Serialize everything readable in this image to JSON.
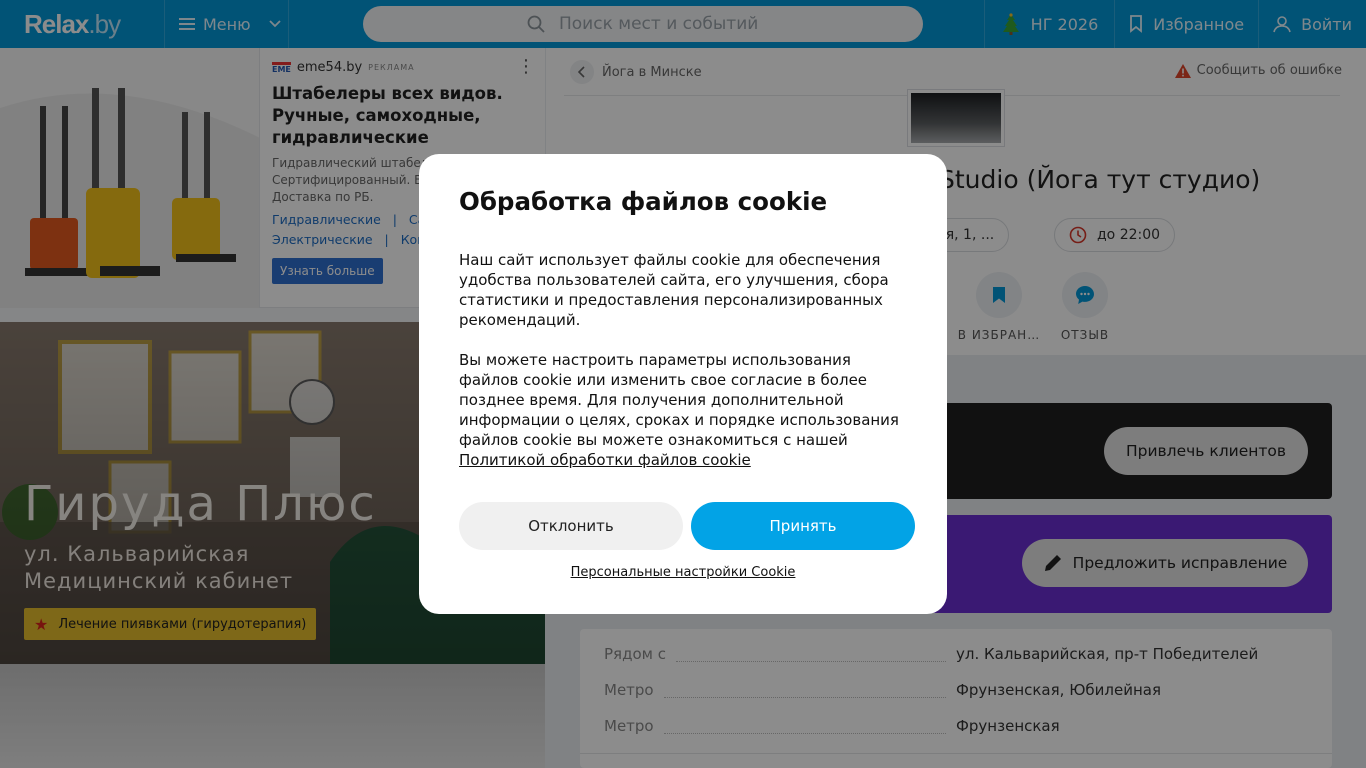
{
  "header": {
    "logo_main": "Relax",
    "logo_domain": ".by",
    "menu_label": "Меню",
    "search_placeholder": "Поиск мест и событий",
    "ny_label": "НГ 2026",
    "favorites_label": "Избранное",
    "login_label": "Войти",
    "colors": {
      "bar": "#0398d8"
    }
  },
  "ad": {
    "brand": "eme54.by",
    "brand_logo_text": "EME",
    "tag": "РЕКЛАМА",
    "title": "Штабелеры всех видов. Ручные, самоходные, гидравлические",
    "text": "Гидравлический штабел… Сертифицированный. Ви… Доставка по РБ.",
    "text_lines": [
      "Гидравлический штабел",
      "Сертифицированный. Ви",
      "Доставка по РБ."
    ],
    "links_row1": [
      "Гидравлические",
      "|",
      "Сам"
    ],
    "links_row2": [
      "Электрические",
      "|",
      "Ком"
    ],
    "button": "Узнать больше"
  },
  "promo": {
    "title": "Гируда Плюс",
    "subtitle1": "ул. Кальварийская",
    "subtitle2": "Медицинский кабинет",
    "tag": "Лечение пиявками (гирудотерапия)"
  },
  "venue": {
    "breadcrumb": "Йога в Минске",
    "report": "Сообщить об ошибке",
    "title": "Studio (Йога тут студио)",
    "address_chip": "ская, 1, ...",
    "hours_chip": "до 22:00",
    "actions": [
      {
        "label": "В ИЗБРАН…",
        "icon": "bookmark-icon"
      },
      {
        "label": "ОТЗЫВ",
        "icon": "chat-icon"
      }
    ],
    "attract_button": "Привлечь клиентов",
    "suggest_button": "Предложить исправление",
    "info": [
      {
        "key": "Рядом с",
        "value": "ул. Кальварийская, пр-т Победителей"
      },
      {
        "key": "Метро",
        "value": "Фрунзенская, Юбилейная"
      },
      {
        "key": "Метро",
        "value": "Фрунзенская"
      }
    ]
  },
  "cookie": {
    "title": "Обработка файлов cookie",
    "paragraph1": "Наш сайт использует файлы cookie для обеспечения удобства пользователей сайта, его улучшения, сбора статистики и предоставления персонализированных рекомендаций.",
    "paragraph2": "Вы можете настроить параметры использования файлов cookie или изменить свое согласие в более позднее время. Для получения дополнительной информации о целях, сроках и порядке использования файлов cookie вы можете ознакомиться с нашей",
    "policy_link": "Политикой обработки файлов cookie",
    "decline": "Отклонить",
    "accept": "Принять",
    "settings": "Персональные настройки Cookie",
    "colors": {
      "accept": "#02a3e6"
    }
  }
}
